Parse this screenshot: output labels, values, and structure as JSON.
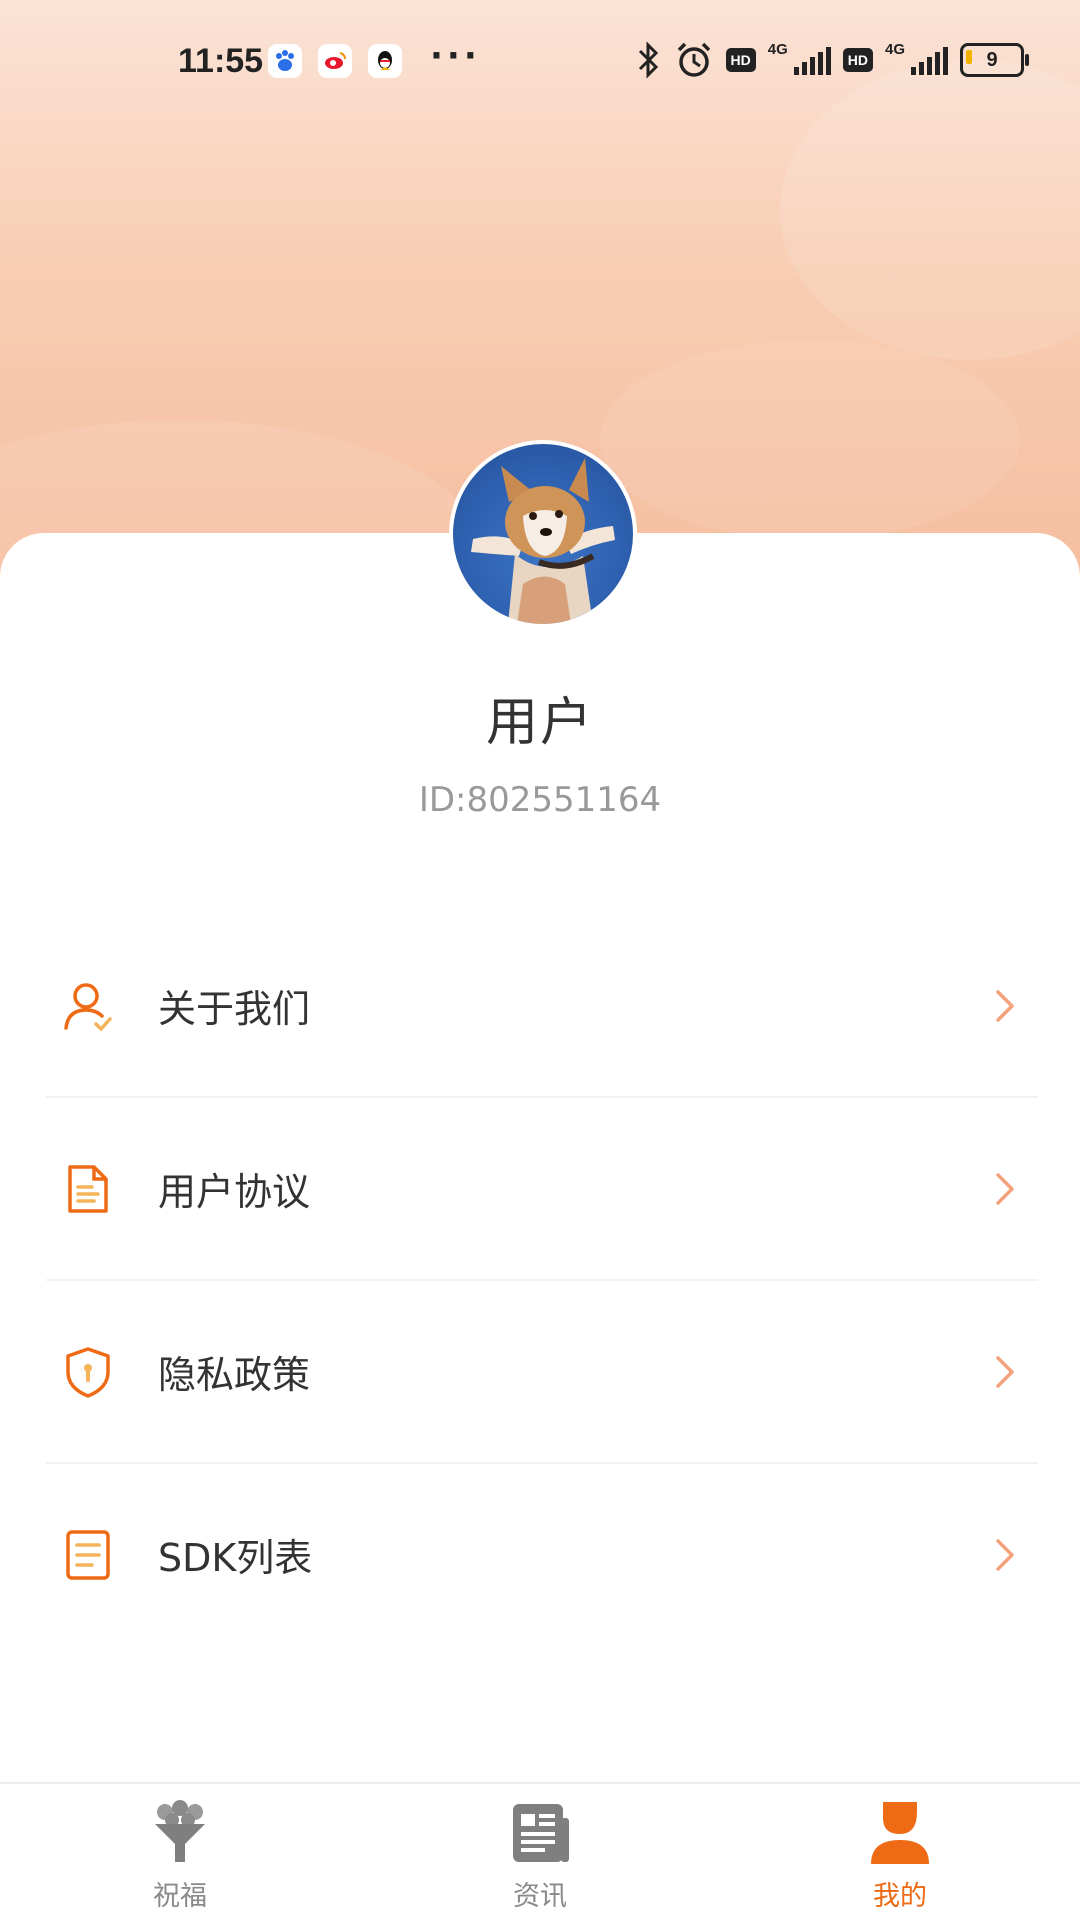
{
  "status_bar": {
    "time": "11:55",
    "notification_icons": [
      "baidu-icon",
      "weibo-icon",
      "qq-icon"
    ],
    "more": "···",
    "network_1": "4G",
    "network_2": "4G",
    "hd_1": "HD",
    "hd_2": "HD",
    "battery_level": "9"
  },
  "profile": {
    "username": "用户",
    "user_id": "ID:802551164",
    "avatar": "corgi-photo"
  },
  "menu": {
    "items": [
      {
        "label": "关于我们",
        "icon": "user-check-icon"
      },
      {
        "label": "用户协议",
        "icon": "document-icon"
      },
      {
        "label": "隐私政策",
        "icon": "shield-icon"
      },
      {
        "label": "SDK列表",
        "icon": "list-icon"
      }
    ]
  },
  "tabbar": {
    "tabs": [
      {
        "label": "祝福",
        "icon": "bouquet-icon",
        "active": false
      },
      {
        "label": "资讯",
        "icon": "news-icon",
        "active": false
      },
      {
        "label": "我的",
        "icon": "profile-icon",
        "active": true
      }
    ]
  },
  "colors": {
    "accent": "#ef6a14",
    "chevron": "#f4a27c",
    "hero_gradient_top": "#fbe3d6",
    "hero_gradient_bottom": "#f6bd9e",
    "inactive_tab": "#8a8a8a"
  }
}
